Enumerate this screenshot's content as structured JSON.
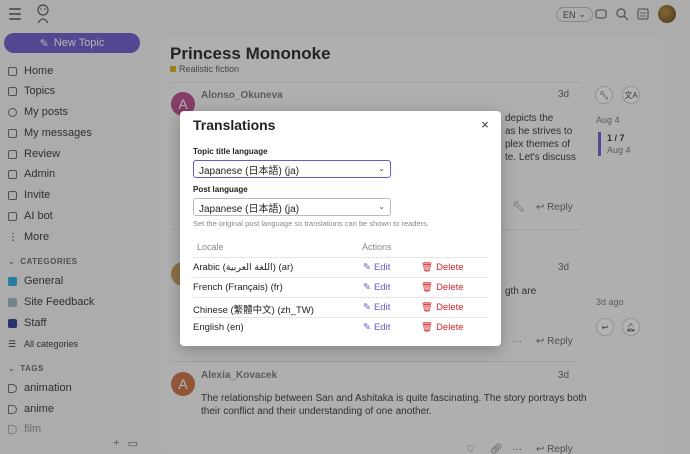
{
  "header": {
    "lang_label": "EN",
    "icons": [
      "hamburger-icon",
      "logo",
      "chat-icon",
      "search-icon",
      "notifications-icon",
      "user-avatar"
    ]
  },
  "sidebar": {
    "new_topic_label": "New Topic",
    "nav": [
      {
        "label": "Home",
        "icon": "home-icon"
      },
      {
        "label": "Topics",
        "icon": "topics-icon"
      },
      {
        "label": "My posts",
        "icon": "user-icon"
      },
      {
        "label": "My messages",
        "icon": "inbox-icon"
      },
      {
        "label": "Review",
        "icon": "review-icon"
      },
      {
        "label": "Admin",
        "icon": "wrench-icon"
      },
      {
        "label": "Invite",
        "icon": "invite-icon"
      },
      {
        "label": "AI bot",
        "icon": "robot-icon"
      },
      {
        "label": "More",
        "icon": "more-icon"
      }
    ],
    "categories_heading": "CATEGORIES",
    "categories": [
      {
        "label": "General",
        "color": "#25aae2"
      },
      {
        "label": "Site Feedback",
        "color": "#9bb5c4"
      },
      {
        "label": "Staff",
        "color": "#283890"
      }
    ],
    "all_categories_label": "All categories",
    "tags_heading": "TAGS",
    "tags": [
      "animation",
      "anime",
      "film"
    ]
  },
  "topic": {
    "title": "Princess Mononoke",
    "category": "Realistic fiction",
    "category_color": "#d4b106"
  },
  "posts": [
    {
      "avatar_letter": "A",
      "avatar_color": "#b94a8a",
      "username": "Alonso_Okuneva",
      "date": "3d",
      "text_lines": [
        "depicts the",
        "as he strives to",
        "plex themes of",
        "te. Let's discuss"
      ],
      "reply_label": "Reply"
    },
    {
      "avatar_letter": "",
      "avatar_color": "#c49a5a",
      "username": "",
      "date": "3d",
      "text_lines": [
        "gth are"
      ],
      "reply_label": "Reply"
    },
    {
      "avatar_letter": "A",
      "avatar_color": "#cc6e3f",
      "username": "Alexia_Kovacek",
      "date": "3d",
      "text_lines": [
        "The relationship between San and Ashitaka is quite fascinating. The story portrays both",
        "their conflict and their understanding of one another."
      ],
      "reply_label": "Reply"
    }
  ],
  "timeline": {
    "date_top": "Aug 4",
    "position": "1 / 7",
    "date_bottom": "Aug 4",
    "last_activity": "3d ago"
  },
  "modal": {
    "title": "Translations",
    "close_label": "×",
    "topic_title_language_label": "Topic title language",
    "topic_title_language_value": "Japanese (日本語) (ja)",
    "post_language_label": "Post language",
    "post_language_value": "Japanese (日本語) (ja)",
    "help_text": "Set the original post language so translations can be shown to readers.",
    "col_locale": "Locale",
    "col_actions": "Actions",
    "rows": [
      {
        "locale": "Arabic (اللغة العربية) (ar)",
        "edit": "Edit",
        "delete": "Delete"
      },
      {
        "locale": "French (Français) (fr)",
        "edit": "Edit",
        "delete": "Delete"
      },
      {
        "locale": "Chinese (繁體中文) (zh_TW)",
        "edit": "Edit",
        "delete": "Delete"
      },
      {
        "locale": "English (en)",
        "edit": "Edit",
        "delete": "Delete"
      }
    ]
  }
}
